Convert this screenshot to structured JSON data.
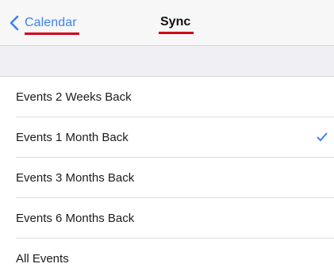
{
  "nav": {
    "back_label": "Calendar",
    "title": "Sync"
  },
  "options": [
    {
      "label": "Events 2 Weeks Back",
      "selected": false
    },
    {
      "label": "Events 1 Month Back",
      "selected": true
    },
    {
      "label": "Events 3 Months Back",
      "selected": false
    },
    {
      "label": "Events 6 Months Back",
      "selected": false
    },
    {
      "label": "All Events",
      "selected": false
    }
  ],
  "icons": {
    "back": "chevron-left-icon",
    "selected": "checkmark-icon"
  },
  "colors": {
    "accent": "#3b82f6",
    "annotation_underline": "#d0021b",
    "background": "#efeff4"
  }
}
